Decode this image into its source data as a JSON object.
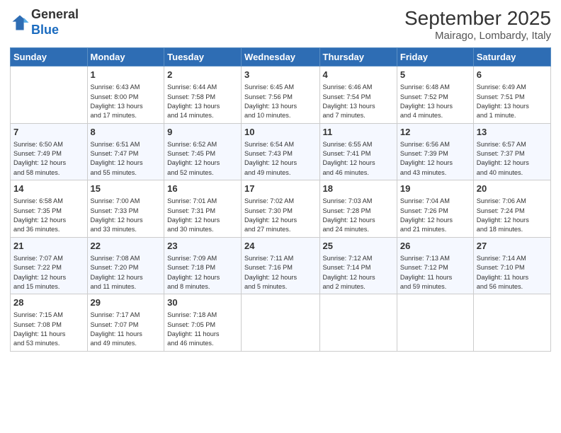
{
  "logo": {
    "text1": "General",
    "text2": "Blue"
  },
  "header": {
    "month_year": "September 2025",
    "location": "Mairago, Lombardy, Italy"
  },
  "days_of_week": [
    "Sunday",
    "Monday",
    "Tuesday",
    "Wednesday",
    "Thursday",
    "Friday",
    "Saturday"
  ],
  "weeks": [
    [
      {
        "day": "",
        "info": ""
      },
      {
        "day": "1",
        "info": "Sunrise: 6:43 AM\nSunset: 8:00 PM\nDaylight: 13 hours\nand 17 minutes."
      },
      {
        "day": "2",
        "info": "Sunrise: 6:44 AM\nSunset: 7:58 PM\nDaylight: 13 hours\nand 14 minutes."
      },
      {
        "day": "3",
        "info": "Sunrise: 6:45 AM\nSunset: 7:56 PM\nDaylight: 13 hours\nand 10 minutes."
      },
      {
        "day": "4",
        "info": "Sunrise: 6:46 AM\nSunset: 7:54 PM\nDaylight: 13 hours\nand 7 minutes."
      },
      {
        "day": "5",
        "info": "Sunrise: 6:48 AM\nSunset: 7:52 PM\nDaylight: 13 hours\nand 4 minutes."
      },
      {
        "day": "6",
        "info": "Sunrise: 6:49 AM\nSunset: 7:51 PM\nDaylight: 13 hours\nand 1 minute."
      }
    ],
    [
      {
        "day": "7",
        "info": "Sunrise: 6:50 AM\nSunset: 7:49 PM\nDaylight: 12 hours\nand 58 minutes."
      },
      {
        "day": "8",
        "info": "Sunrise: 6:51 AM\nSunset: 7:47 PM\nDaylight: 12 hours\nand 55 minutes."
      },
      {
        "day": "9",
        "info": "Sunrise: 6:52 AM\nSunset: 7:45 PM\nDaylight: 12 hours\nand 52 minutes."
      },
      {
        "day": "10",
        "info": "Sunrise: 6:54 AM\nSunset: 7:43 PM\nDaylight: 12 hours\nand 49 minutes."
      },
      {
        "day": "11",
        "info": "Sunrise: 6:55 AM\nSunset: 7:41 PM\nDaylight: 12 hours\nand 46 minutes."
      },
      {
        "day": "12",
        "info": "Sunrise: 6:56 AM\nSunset: 7:39 PM\nDaylight: 12 hours\nand 43 minutes."
      },
      {
        "day": "13",
        "info": "Sunrise: 6:57 AM\nSunset: 7:37 PM\nDaylight: 12 hours\nand 40 minutes."
      }
    ],
    [
      {
        "day": "14",
        "info": "Sunrise: 6:58 AM\nSunset: 7:35 PM\nDaylight: 12 hours\nand 36 minutes."
      },
      {
        "day": "15",
        "info": "Sunrise: 7:00 AM\nSunset: 7:33 PM\nDaylight: 12 hours\nand 33 minutes."
      },
      {
        "day": "16",
        "info": "Sunrise: 7:01 AM\nSunset: 7:31 PM\nDaylight: 12 hours\nand 30 minutes."
      },
      {
        "day": "17",
        "info": "Sunrise: 7:02 AM\nSunset: 7:30 PM\nDaylight: 12 hours\nand 27 minutes."
      },
      {
        "day": "18",
        "info": "Sunrise: 7:03 AM\nSunset: 7:28 PM\nDaylight: 12 hours\nand 24 minutes."
      },
      {
        "day": "19",
        "info": "Sunrise: 7:04 AM\nSunset: 7:26 PM\nDaylight: 12 hours\nand 21 minutes."
      },
      {
        "day": "20",
        "info": "Sunrise: 7:06 AM\nSunset: 7:24 PM\nDaylight: 12 hours\nand 18 minutes."
      }
    ],
    [
      {
        "day": "21",
        "info": "Sunrise: 7:07 AM\nSunset: 7:22 PM\nDaylight: 12 hours\nand 15 minutes."
      },
      {
        "day": "22",
        "info": "Sunrise: 7:08 AM\nSunset: 7:20 PM\nDaylight: 12 hours\nand 11 minutes."
      },
      {
        "day": "23",
        "info": "Sunrise: 7:09 AM\nSunset: 7:18 PM\nDaylight: 12 hours\nand 8 minutes."
      },
      {
        "day": "24",
        "info": "Sunrise: 7:11 AM\nSunset: 7:16 PM\nDaylight: 12 hours\nand 5 minutes."
      },
      {
        "day": "25",
        "info": "Sunrise: 7:12 AM\nSunset: 7:14 PM\nDaylight: 12 hours\nand 2 minutes."
      },
      {
        "day": "26",
        "info": "Sunrise: 7:13 AM\nSunset: 7:12 PM\nDaylight: 11 hours\nand 59 minutes."
      },
      {
        "day": "27",
        "info": "Sunrise: 7:14 AM\nSunset: 7:10 PM\nDaylight: 11 hours\nand 56 minutes."
      }
    ],
    [
      {
        "day": "28",
        "info": "Sunrise: 7:15 AM\nSunset: 7:08 PM\nDaylight: 11 hours\nand 53 minutes."
      },
      {
        "day": "29",
        "info": "Sunrise: 7:17 AM\nSunset: 7:07 PM\nDaylight: 11 hours\nand 49 minutes."
      },
      {
        "day": "30",
        "info": "Sunrise: 7:18 AM\nSunset: 7:05 PM\nDaylight: 11 hours\nand 46 minutes."
      },
      {
        "day": "",
        "info": ""
      },
      {
        "day": "",
        "info": ""
      },
      {
        "day": "",
        "info": ""
      },
      {
        "day": "",
        "info": ""
      }
    ]
  ]
}
